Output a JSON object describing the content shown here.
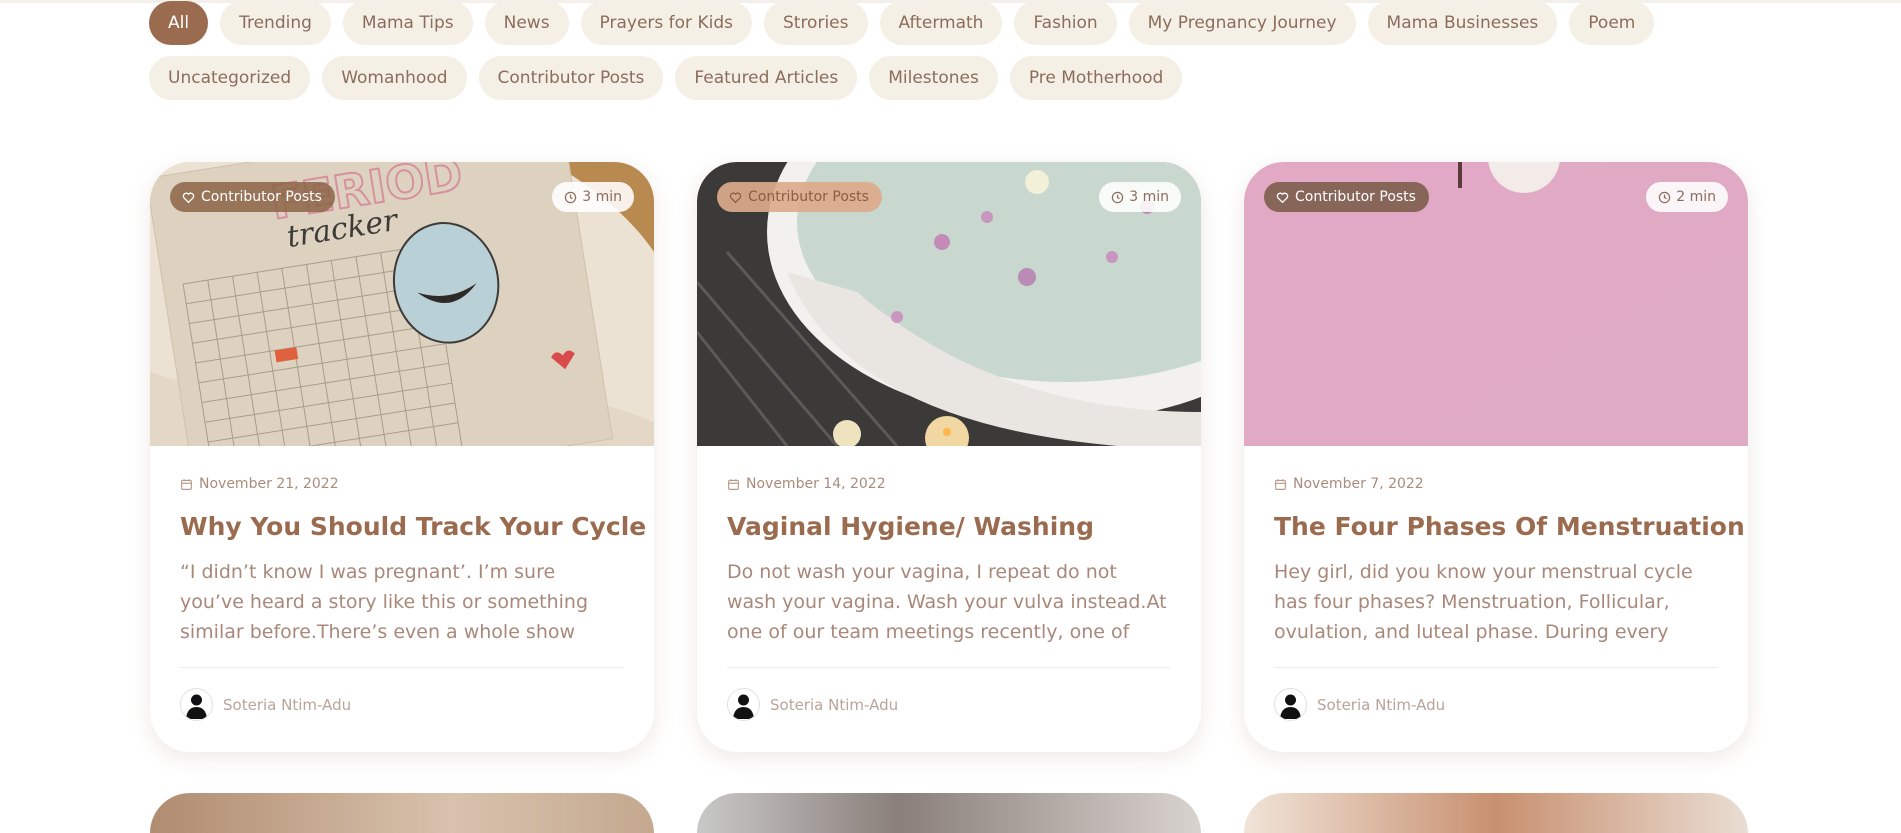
{
  "categories": {
    "row1": [
      "All",
      "Trending",
      "Mama Tips",
      "News",
      "Prayers for Kids",
      "Strories",
      "Aftermath",
      "Fashion",
      "My Pregnancy Journey",
      "Mama Businesses",
      "Poem"
    ],
    "row2": [
      "Uncategorized",
      "Womanhood",
      "Contributor Posts",
      "Featured Articles",
      "Milestones",
      "Pre Motherhood"
    ],
    "active": "All"
  },
  "posts": [
    {
      "category": "Contributor Posts",
      "read_time": "3 min",
      "date": "November 21, 2022",
      "title": "Why You Should Track Your Cycle",
      "excerpt": "“I didn’t know I was pregnant’. I’m sure you’ve heard a story like this or something similar before.There’s even a whole show called I didn’…",
      "author": "Soteria Ntim-Adu",
      "image_label": "FERIOD tracker"
    },
    {
      "category": "Contributor Posts",
      "read_time": "3 min",
      "date": "November 14, 2022",
      "title": "Vaginal Hygiene/ Washing",
      "excerpt": "Do not wash your vagina, I repeat do not wash your vagina. Wash your vulva instead.At one of our team meetings recently, one of us…",
      "author": "Soteria Ntim-Adu"
    },
    {
      "category": "Contributor Posts",
      "read_time": "2 min",
      "date": "November 7, 2022",
      "title": "The Four Phases Of Menstruation",
      "excerpt": "Hey girl, did you know your menstrual cycle has four phases? Menstruation, Follicular, ovulation, and luteal phase. During every phase, we…",
      "author": "Soteria Ntim-Adu"
    }
  ],
  "icons": {
    "category": "heart-icon",
    "read_time": "clock-icon",
    "date": "calendar-icon",
    "author": "avatar-icon"
  },
  "colors": {
    "accent": "#9a6b4f",
    "chip_bg": "#f5f0e6",
    "text": "#a8887a"
  }
}
